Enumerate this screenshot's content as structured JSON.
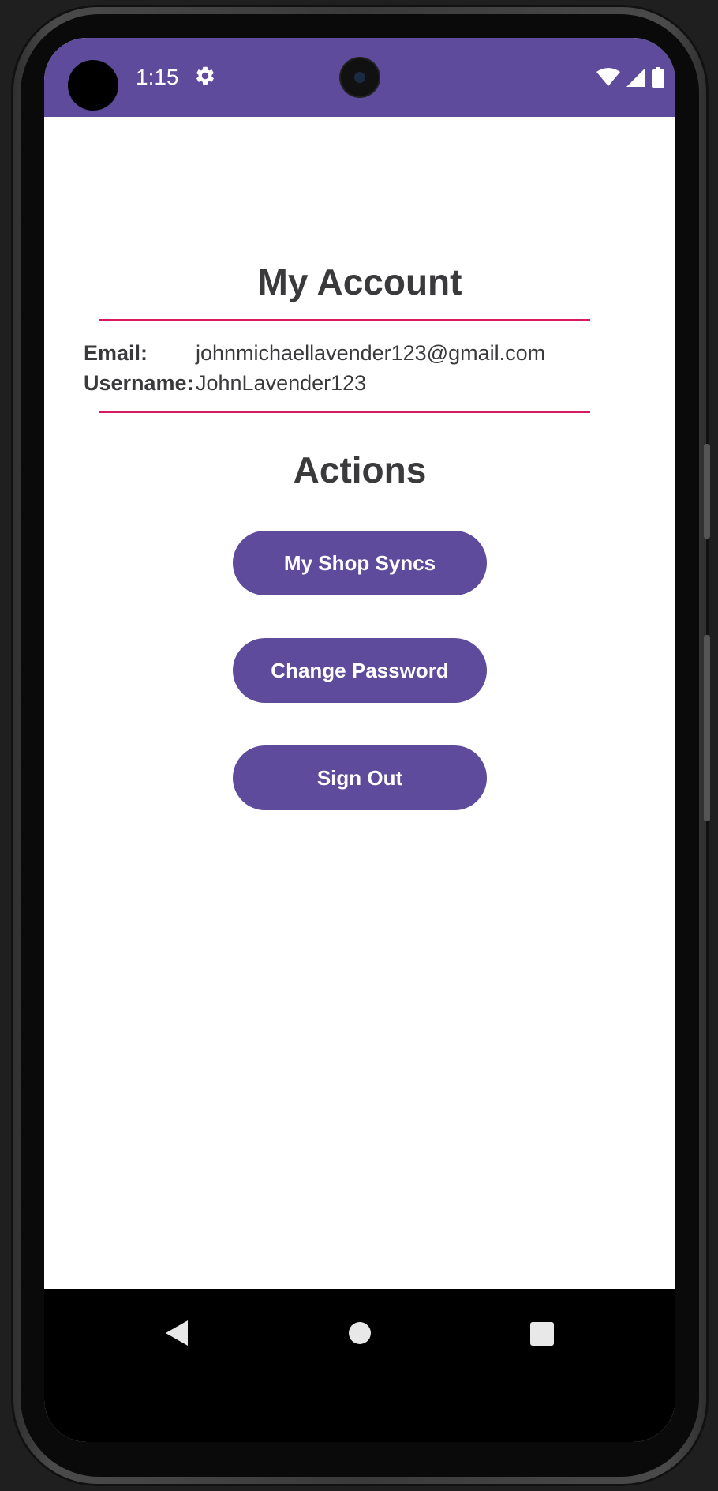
{
  "status_bar": {
    "time": "1:15",
    "icons": [
      "settings-gear-icon",
      "wifi-icon",
      "signal-icon",
      "battery-icon"
    ],
    "color": "#5f4b9b"
  },
  "account": {
    "title": "My Account",
    "email_label": "Email:",
    "email_value": "johnmichaellavender123@gmail.com",
    "username_label": "Username:",
    "username_value": "JohnLavender123"
  },
  "actions": {
    "title": "Actions",
    "buttons": [
      {
        "label": "My Shop Syncs"
      },
      {
        "label": "Change Password"
      },
      {
        "label": "Sign Out"
      }
    ]
  },
  "navigation": {
    "icons": [
      "back-icon",
      "home-icon",
      "recents-icon"
    ]
  },
  "colors": {
    "accent": "#5f4b9b",
    "divider": "#d81b60",
    "text": "#3a3a3d"
  }
}
